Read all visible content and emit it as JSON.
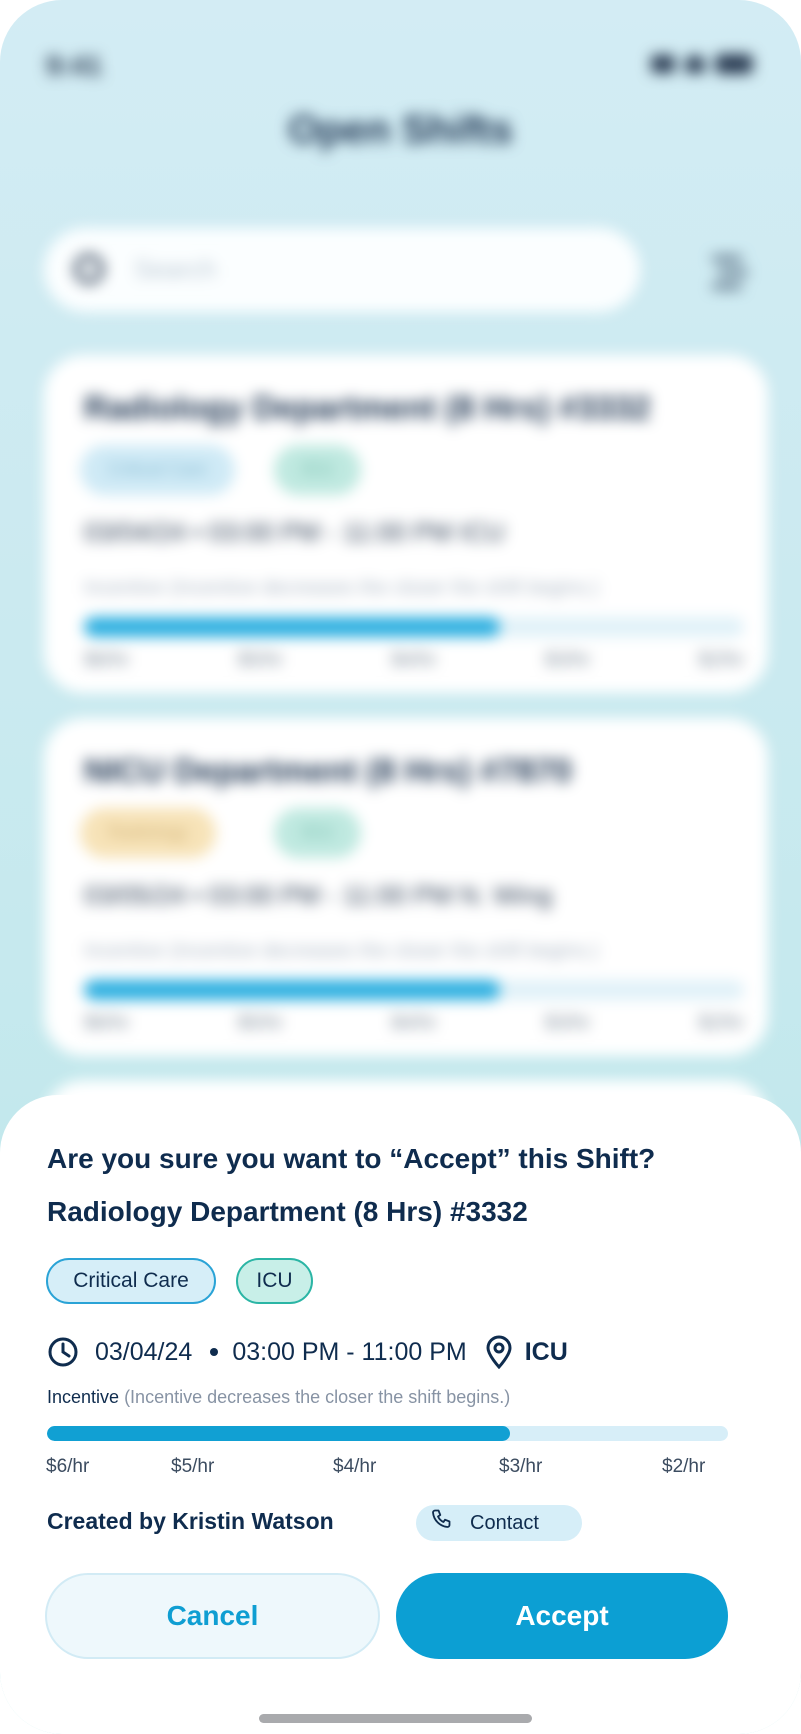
{
  "status_bar": {
    "time": "9:41"
  },
  "background": {
    "title": "Open Shifts",
    "search_placeholder": "Search",
    "cards": [
      {
        "title": "Radiology Department (8 Hrs) #3332",
        "chips": [
          "Critical Care",
          "ICU"
        ],
        "meta": "03/04/24 • 03:00 PM - 11:00 PM  ICU",
        "note": "Incentive (Incentive decreases the closer the shift begins.)",
        "ticks": [
          "$6/hr",
          "$5/hr",
          "$4/hr",
          "$3/hr",
          "$2/hr"
        ]
      },
      {
        "title": "NICU Department (8 Hrs) #7870",
        "chips": [
          "Radiology",
          "ICU"
        ],
        "meta": "03/05/24 • 03:00 PM - 11:00 PM  N. Wing",
        "note": "Incentive (Incentive decreases the closer the shift begins.)",
        "ticks": [
          "$6/hr",
          "$5/hr",
          "$4/hr",
          "$3/hr",
          "$2/hr"
        ]
      }
    ]
  },
  "sheet": {
    "question": "Are you sure you want to “Accept” this Shift?",
    "shift_title": "Radiology Department (8 Hrs) #3332",
    "chips": {
      "critical_care": "Critical Care",
      "icu": "ICU"
    },
    "date": "03/04/24",
    "time_range": "03:00 PM - 11:00 PM",
    "location": "ICU",
    "incentive_label": "Incentive",
    "incentive_note": "(Incentive decreases the closer the shift begins.)",
    "incentive_progress": 0.68,
    "ticks": [
      "$6/hr",
      "$5/hr",
      "$4/hr",
      "$3/hr",
      "$2/hr"
    ],
    "created_by": "Created by Kristin Watson",
    "contact_label": "Contact",
    "cancel_label": "Cancel",
    "accept_label": "Accept"
  },
  "colors": {
    "accent": "#0c9fd3",
    "text_dark": "#0f2c4e",
    "chip_blue_bg": "#d6eef8",
    "chip_teal_bg": "#c8efe8"
  }
}
